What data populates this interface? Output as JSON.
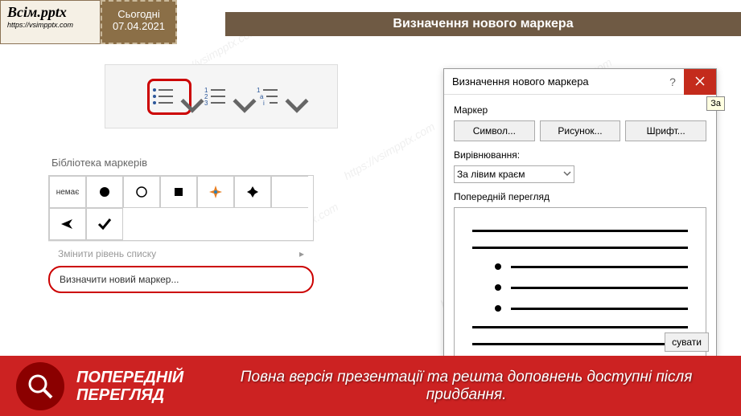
{
  "header": {
    "logo_text": "Всім.pptx",
    "logo_url": "https://vsimpptx.com",
    "today_label": "Сьогодні",
    "date": "07.04.2021"
  },
  "title_bar": "Визначення нового маркера",
  "library": {
    "title": "Бібліотека маркерів",
    "none_label": "немає",
    "change_level": "Змінити рівень списку",
    "define_new": "Визначити новий маркер..."
  },
  "dialog": {
    "title": "Визначення нового маркера",
    "marker_label": "Маркер",
    "symbol_btn": "Символ...",
    "picture_btn": "Рисунок...",
    "font_btn": "Шрифт...",
    "alignment_label": "Вирівнювання:",
    "alignment_value": "За лівим краєм",
    "preview_label": "Попередній перегляд",
    "cancel_btn": "сувати",
    "tooltip": "За"
  },
  "footer": {
    "label_line1": "ПОПЕРЕДНІЙ",
    "label_line2": "ПЕРЕГЛЯД",
    "text": "Повна версія презентації та решта доповнень доступні після придбання."
  },
  "watermark": "https://vsimpptx.com"
}
